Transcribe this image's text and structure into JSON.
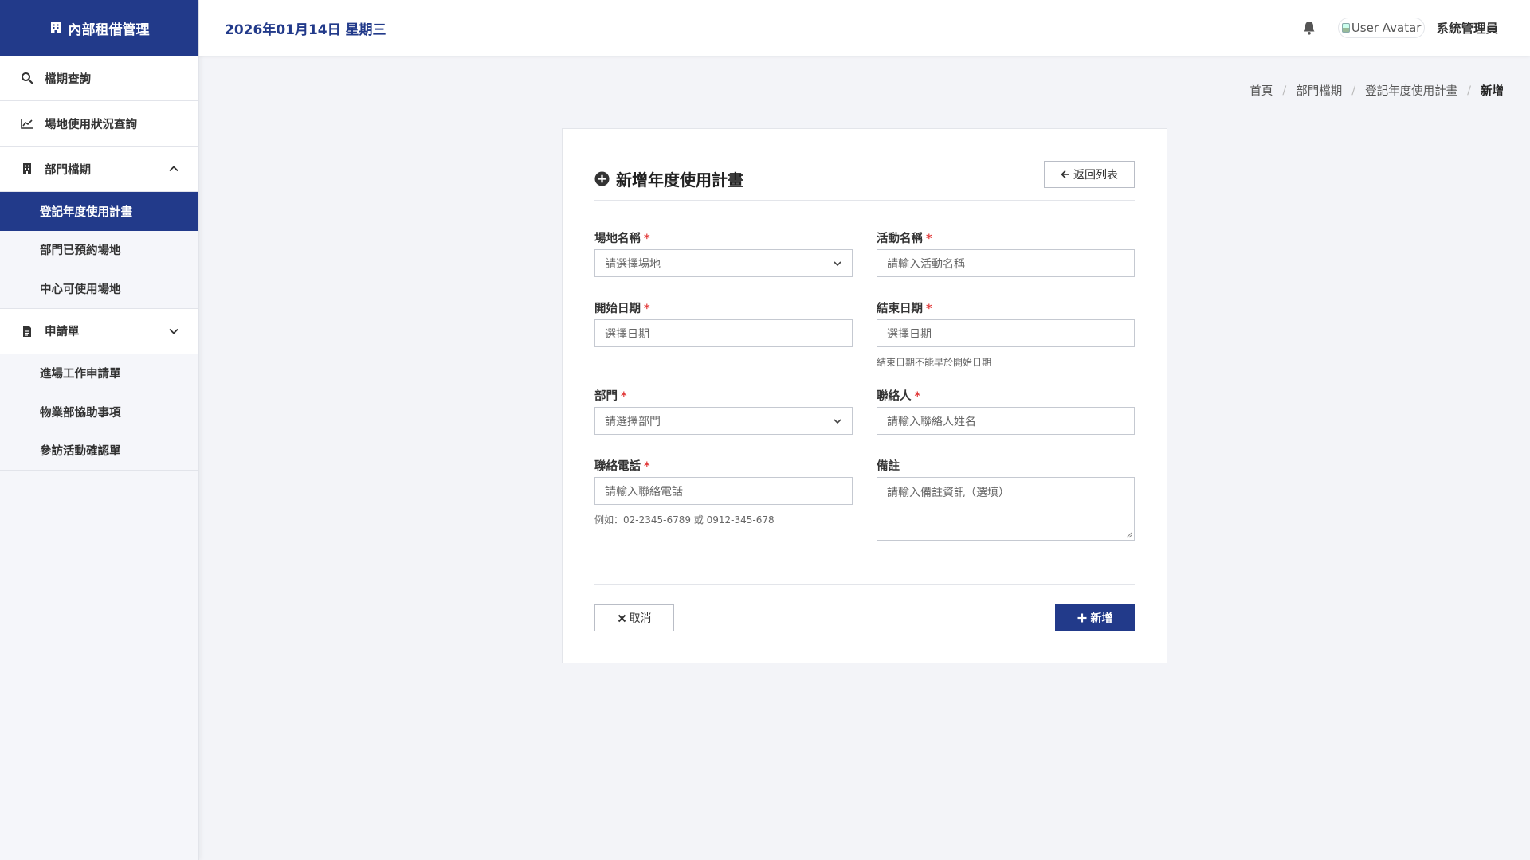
{
  "app": {
    "title": "內部租借管理"
  },
  "header": {
    "date": "2026年01月14日 星期三",
    "avatar_alt": "User Avatar",
    "username": "系統管理員"
  },
  "sidebar": {
    "items": [
      {
        "label": "檔期查詢",
        "icon": "search-icon"
      },
      {
        "label": "場地使用狀況查詢",
        "icon": "line-chart-icon"
      },
      {
        "label": "部門檔期",
        "icon": "building-icon",
        "expanded": true,
        "children": [
          "登記年度使用計畫",
          "部門已預約場地",
          "中心可使用場地"
        ]
      },
      {
        "label": "申請單",
        "icon": "document-icon",
        "expanded": true,
        "children": [
          "進場工作申請單",
          "物業部協助事項",
          "參訪活動確認單"
        ]
      }
    ],
    "active": "登記年度使用計畫"
  },
  "breadcrumb": [
    "首頁",
    "部門檔期",
    "登記年度使用計畫",
    "新增"
  ],
  "form": {
    "title": "新增年度使用計畫",
    "back_label": "返回列表",
    "venue": {
      "label": "場地名稱",
      "placeholder": "請選擇場地"
    },
    "activity": {
      "label": "活動名稱",
      "placeholder": "請輸入活動名稱"
    },
    "start_date": {
      "label": "開始日期",
      "placeholder": "選擇日期"
    },
    "end_date": {
      "label": "結束日期",
      "placeholder": "選擇日期",
      "hint": "結束日期不能早於開始日期"
    },
    "department": {
      "label": "部門",
      "placeholder": "請選擇部門"
    },
    "contact": {
      "label": "聯絡人",
      "placeholder": "請輸入聯絡人姓名"
    },
    "phone": {
      "label": "聯絡電話",
      "placeholder": "請輸入聯絡電話",
      "hint": "例如：02-2345-6789 或 0912-345-678"
    },
    "notes": {
      "label": "備註",
      "placeholder": "請輸入備註資訊（選填）"
    },
    "required_mark": "*",
    "cancel_label": "取消",
    "submit_label": "新增"
  },
  "colors": {
    "primary": "#223a8a",
    "required": "#e23b3b",
    "background": "#f3f4f8"
  }
}
